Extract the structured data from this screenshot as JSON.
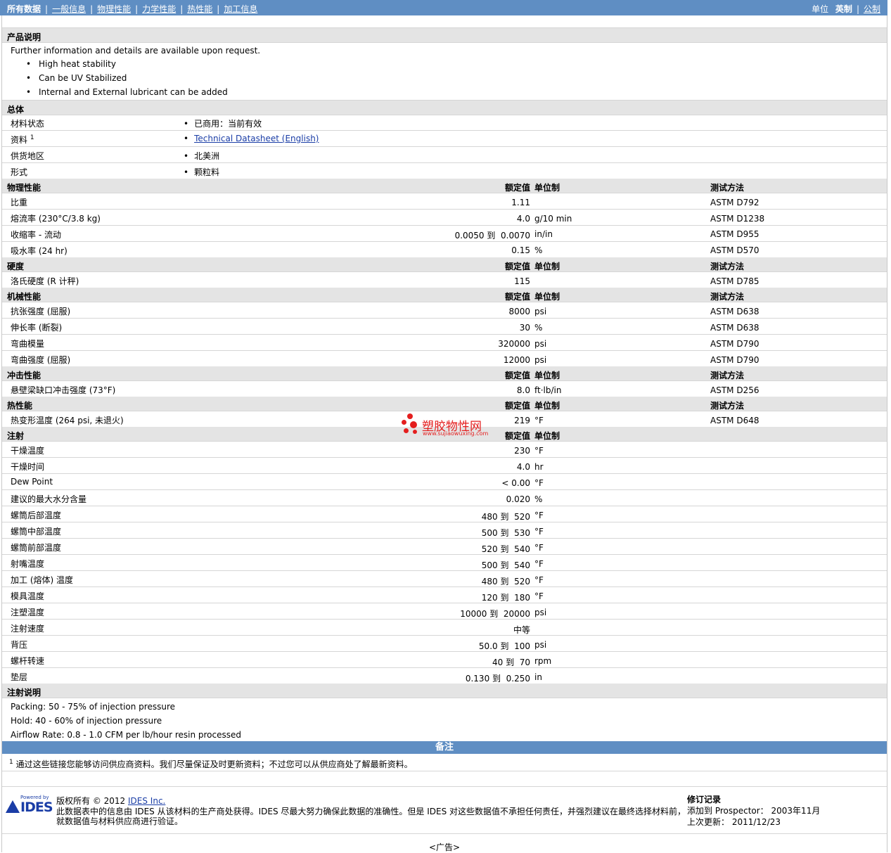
{
  "nav": {
    "all": "所有数据",
    "items": [
      "一般信息",
      "物理性能",
      "力学性能",
      "热性能",
      "加工信息"
    ],
    "units_label": "单位",
    "unit_selected": "英制",
    "unit_other": "公制"
  },
  "product": {
    "header": "产品说明",
    "intro": "Further information and details are available upon request.",
    "bullets": [
      "High heat stability",
      "Can be UV Stabilized",
      "Internal and External lubricant can be added"
    ]
  },
  "general": {
    "header": "总体",
    "rows": [
      {
        "label": "材料状态",
        "value": "已商用：当前有效"
      },
      {
        "label": "资料",
        "sup": "1",
        "value": "Technical Datasheet (English)"
      },
      {
        "label": "供货地区",
        "value": "北美洲"
      },
      {
        "label": "形式",
        "value": "颗粒料"
      }
    ]
  },
  "col": {
    "value": "额定值",
    "unit": "单位制",
    "method": "测试方法"
  },
  "physical": {
    "header": "物理性能",
    "rows": [
      {
        "label": "比重",
        "value": "1.11",
        "unit": "",
        "method": "ASTM D792"
      },
      {
        "label": "熔流率 (230°C/3.8 kg)",
        "value": "4.0",
        "unit": "g/10 min",
        "method": "ASTM D1238"
      },
      {
        "label": "收缩率 - 流动",
        "value": "0.0050 到  0.0070",
        "unit": "in/in",
        "method": "ASTM D955"
      },
      {
        "label": "吸水率 (24 hr)",
        "value": "0.15",
        "unit": "%",
        "method": "ASTM D570"
      }
    ]
  },
  "hardness": {
    "header": "硬度",
    "rows": [
      {
        "label": "洛氏硬度 (R 计秤)",
        "value": "115",
        "unit": "",
        "method": "ASTM D785"
      }
    ]
  },
  "mechanical": {
    "header": "机械性能",
    "rows": [
      {
        "label": "抗张强度 (屈服)",
        "value": "8000",
        "unit": "psi",
        "method": "ASTM D638"
      },
      {
        "label": "伸长率 (断裂)",
        "value": "30",
        "unit": "%",
        "method": "ASTM D638"
      },
      {
        "label": "弯曲模量",
        "value": "320000",
        "unit": "psi",
        "method": "ASTM D790"
      },
      {
        "label": "弯曲强度 (屈服)",
        "value": "12000",
        "unit": "psi",
        "method": "ASTM D790"
      }
    ]
  },
  "impact": {
    "header": "冲击性能",
    "rows": [
      {
        "label": "悬壁梁缺口冲击强度 (73°F)",
        "value": "8.0",
        "unit": "ft·lb/in",
        "method": "ASTM D256"
      }
    ]
  },
  "thermal": {
    "header": "热性能",
    "rows": [
      {
        "label": "热变形温度 (264 psi, 未退火)",
        "value": "219",
        "unit": "°F",
        "method": "ASTM D648"
      }
    ]
  },
  "injection": {
    "header": "注射",
    "rows": [
      {
        "label": "干燥温度",
        "value": "230",
        "unit": "°F"
      },
      {
        "label": "干燥时间",
        "value": "4.0",
        "unit": "hr"
      },
      {
        "label": "Dew Point",
        "value": "< 0.00",
        "unit": "°F"
      },
      {
        "label": "建议的最大水分含量",
        "value": "0.020",
        "unit": "%"
      },
      {
        "label": "螺筒后部温度",
        "value": "480 到  520",
        "unit": "°F"
      },
      {
        "label": "螺筒中部温度",
        "value": "500 到  530",
        "unit": "°F"
      },
      {
        "label": "螺筒前部温度",
        "value": "520 到  540",
        "unit": "°F"
      },
      {
        "label": "射嘴温度",
        "value": "500 到  540",
        "unit": "°F"
      },
      {
        "label": "加工 (熔体) 温度",
        "value": "480 到  520",
        "unit": "°F"
      },
      {
        "label": "模具温度",
        "value": "120 到  180",
        "unit": "°F"
      },
      {
        "label": "注塑温度",
        "value": "10000 到  20000",
        "unit": "psi"
      },
      {
        "label": "注射速度",
        "value": "中等",
        "unit": ""
      },
      {
        "label": "背压",
        "value": "50.0 到  100",
        "unit": "psi"
      },
      {
        "label": "螺杆转速",
        "value": "40 到  70",
        "unit": "rpm"
      },
      {
        "label": "垫层",
        "value": "0.130 到  0.250",
        "unit": "in"
      }
    ]
  },
  "injection_notes": {
    "header": "注射说明",
    "lines": [
      "Packing: 50 - 75% of injection pressure",
      "Hold: 40 - 60% of injection pressure",
      "Airflow Rate: 0.8 - 1.0 CFM per lb/hour resin processed"
    ]
  },
  "notes": {
    "header": "备注",
    "sup": "1",
    "text": "通过这些链接您能够访问供应商资料。我们尽量保证及时更新资料；不过您可以从供应商处了解最新资料。"
  },
  "watermark": {
    "main": "塑胶物性网",
    "sub": "www.sujiaowuxing.com"
  },
  "footer": {
    "powered": "Powered by",
    "logo": "IDES",
    "copyright_prefix": "版权所有 © 2012",
    "copyright_link": "IDES Inc.",
    "disclaimer_1": "此数据表中的信息由 IDES 从该材料的生产商处获得。IDES 尽最大努力确保此数据的准确性。但是 IDES 对这些数据值不承担任何责任，并强烈建议在最终选择材料前，",
    "disclaimer_2": "就数据值与材料供应商进行验证。",
    "revision_header": "修订记录",
    "added_label": "添加到 Prospector：",
    "added_value": "2003年11月",
    "updated_label": "上次更新：",
    "updated_value": "2011/12/23",
    "ad": "<广告>"
  }
}
